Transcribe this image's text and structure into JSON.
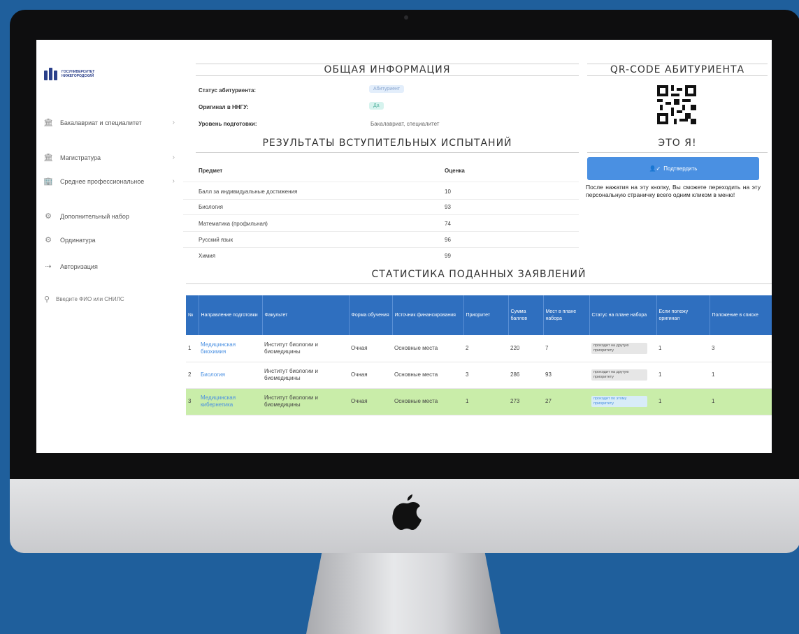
{
  "sidebar": {
    "logo_text": [
      "ГОСУНИВЕРСИТЕТ",
      "НИЖЕГОРОДСКИЙ"
    ],
    "items": [
      {
        "label": "Бакалавриат и специалитет",
        "icon": "university-icon"
      },
      {
        "label": "Магистратура",
        "icon": "university-icon"
      },
      {
        "label": "Среднее профессиональное",
        "icon": "building-icon"
      },
      {
        "label": "Дополнительный набор",
        "icon": "gear-icon"
      },
      {
        "label": "Ординатура",
        "icon": "gear-icon"
      },
      {
        "label": "Авторизация",
        "icon": "login-icon"
      }
    ],
    "search_placeholder": "Введите ФИО или СНИЛС"
  },
  "general": {
    "title": "ОБЩАЯ ИНФОРМАЦИЯ",
    "rows": [
      {
        "label": "Статус абитуриента:",
        "value": "Абитуриент"
      },
      {
        "label": "Оригинал в ННГУ:",
        "value": "Да"
      },
      {
        "label": "Уровень подготовки:",
        "value": "Бакалавриат, специалитет"
      }
    ]
  },
  "qr": {
    "title": "QR-CODE АБИТУРИЕНТА"
  },
  "me": {
    "title": "ЭТО Я!",
    "button_label": "Подтвердить",
    "note": "После нажатия на эту кнопку, Вы сможете переходить на эту персональную страничку всего одним кликом в меню!"
  },
  "results": {
    "title": "РЕЗУЛЬТАТЫ ВСТУПИТЕЛЬНЫХ ИСПЫТАНИЙ",
    "col_subject": "Предмет",
    "col_score": "Оценка",
    "rows": [
      {
        "subject": "Балл за индивидуальные достижения",
        "score": "10"
      },
      {
        "subject": "Биология",
        "score": "93"
      },
      {
        "subject": "Математика (профильная)",
        "score": "74"
      },
      {
        "subject": "Русский язык",
        "score": "96"
      },
      {
        "subject": "Химия",
        "score": "99"
      }
    ]
  },
  "stats": {
    "title": "СТАТИСТИКА ПОДАННЫХ ЗАЯВЛЕНИЙ",
    "headers": [
      "№",
      "Направление подготовки",
      "Факультет",
      "Форма обучения",
      "Источник финансирования",
      "Приоритет",
      "Сумма баллов",
      "Мест в плане набора",
      "Статус на плане набора",
      "Если положу оригинал",
      "Положение в списке"
    ],
    "rows": [
      {
        "n": "1",
        "direction": "Медицинская биохимия",
        "faculty": "Институт биологии и биомедицины",
        "form": "Очная",
        "source": "Основные места",
        "priority": "2",
        "sum": "220",
        "places": "7",
        "status": "проходит на другую приоритету",
        "if_original": "1",
        "position": "3",
        "highlight": false
      },
      {
        "n": "2",
        "direction": "Биология",
        "faculty": "Институт биологии и биомедицины",
        "form": "Очная",
        "source": "Основные места",
        "priority": "3",
        "sum": "286",
        "places": "93",
        "status": "проходит на другую приоритету",
        "if_original": "1",
        "position": "1",
        "highlight": false
      },
      {
        "n": "3",
        "direction": "Медицинская кибернетика",
        "faculty": "Институт биологии и биомедицины",
        "form": "Очная",
        "source": "Основные места",
        "priority": "1",
        "sum": "273",
        "places": "27",
        "status": "проходит по этому приоритету",
        "if_original": "1",
        "position": "1",
        "highlight": true
      }
    ]
  },
  "colors": {
    "background": "#1f5f9c",
    "accent": "#4a90e2",
    "table_header": "#2f6fbf",
    "highlight_row": "#c9eda9"
  }
}
